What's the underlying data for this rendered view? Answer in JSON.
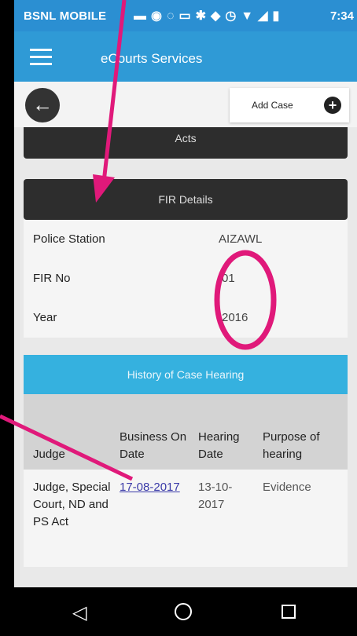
{
  "status_bar": {
    "carrier": "BSNL MOBILE",
    "icons": [
      "message-icon",
      "sync-icon",
      "whatsapp-icon",
      "mail-icon",
      "bluetooth-icon",
      "vibrate-icon",
      "alarm-icon",
      "wifi-icon",
      "signal-icon",
      "battery-icon"
    ],
    "time": "7:34"
  },
  "app_bar": {
    "title": "eCourts Services"
  },
  "toolbar": {
    "add_case_label": "Add Case"
  },
  "acts": {
    "label": "Acts"
  },
  "fir": {
    "header": "FIR Details",
    "rows": [
      {
        "label": "Police Station",
        "value": "AIZAWL"
      },
      {
        "label": "FIR No",
        "value": "01"
      },
      {
        "label": "Year",
        "value": "2016"
      }
    ]
  },
  "history": {
    "header": "History of Case Hearing",
    "columns": [
      "Judge",
      "Business On Date",
      "Hearing Date",
      "Purpose of hearing"
    ],
    "rows": [
      {
        "judge": "Judge, Special Court, ND and PS Act",
        "business_on_date": "17-08-2017",
        "hearing_date": "13-10-2017",
        "purpose": "Evidence"
      }
    ]
  },
  "colors": {
    "status_bar": "#2b8fd2",
    "app_bar": "#2f9ad6",
    "history_header": "#35b1df",
    "dark_header": "#2d2d2d",
    "annotation": "#e0197a"
  }
}
